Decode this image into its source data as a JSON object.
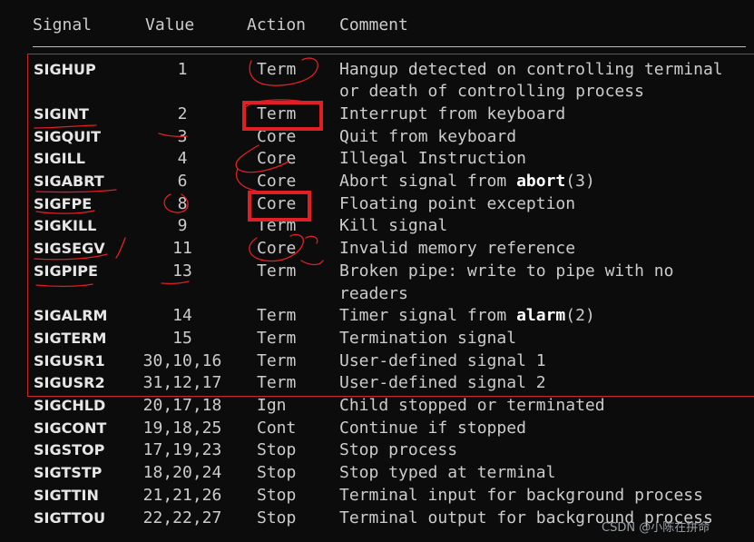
{
  "headers": {
    "signal": "Signal",
    "value": "Value",
    "action": "Action",
    "comment": "Comment"
  },
  "rows": [
    {
      "signal": "SIGHUP",
      "value": "1",
      "action": "Term",
      "comment": "Hangup detected on controlling terminal"
    },
    {
      "signal": "",
      "value": "",
      "action": "",
      "comment": "or death of controlling process"
    },
    {
      "signal": "SIGINT",
      "value": "2",
      "action": "Term",
      "comment": "Interrupt from keyboard"
    },
    {
      "signal": "SIGQUIT",
      "value": "3",
      "action": "Core",
      "comment": "Quit from keyboard"
    },
    {
      "signal": "SIGILL",
      "value": "4",
      "action": "Core",
      "comment": "Illegal Instruction"
    },
    {
      "signal": "SIGABRT",
      "value": "6",
      "action": "Core",
      "comment_pre": "Abort signal from ",
      "comment_kw": "abort",
      "comment_post": "(3)"
    },
    {
      "signal": "SIGFPE",
      "value": "8",
      "action": "Core",
      "comment": "Floating point exception"
    },
    {
      "signal": "SIGKILL",
      "value": "9",
      "action": "Term",
      "comment": "Kill signal"
    },
    {
      "signal": "SIGSEGV",
      "value": "11",
      "action": "Core",
      "comment": "Invalid memory reference"
    },
    {
      "signal": "SIGPIPE",
      "value": "13",
      "action": "Term",
      "comment": "Broken pipe: write to pipe with no"
    },
    {
      "signal": "",
      "value": "",
      "action": "",
      "comment": "readers"
    },
    {
      "signal": "SIGALRM",
      "value": "14",
      "action": "Term",
      "comment_pre": "Timer signal from ",
      "comment_kw": "alarm",
      "comment_post": "(2)"
    },
    {
      "signal": "SIGTERM",
      "value": "15",
      "action": "Term",
      "comment": "Termination signal"
    },
    {
      "signal": "SIGUSR1",
      "value": "30,10,16",
      "action": "Term",
      "comment": "User-defined signal 1"
    },
    {
      "signal": "SIGUSR2",
      "value": "31,12,17",
      "action": "Term",
      "comment": "User-defined signal 2"
    },
    {
      "signal": "SIGCHLD",
      "value": "20,17,18",
      "action": "Ign",
      "comment": "Child stopped or terminated"
    },
    {
      "signal": "SIGCONT",
      "value": "19,18,25",
      "action": "Cont",
      "comment": "Continue if stopped"
    },
    {
      "signal": "SIGSTOP",
      "value": "17,19,23",
      "action": "Stop",
      "comment": "Stop process"
    },
    {
      "signal": "SIGTSTP",
      "value": "18,20,24",
      "action": "Stop",
      "comment": "Stop typed at terminal"
    },
    {
      "signal": "SIGTTIN",
      "value": "21,21,26",
      "action": "Stop",
      "comment": "Terminal input for background process"
    },
    {
      "signal": "SIGTTOU",
      "value": "22,22,27",
      "action": "Stop",
      "comment": "Terminal output for background process"
    }
  ],
  "watermark": "CSDN @小陈在拼命",
  "colors": {
    "background": "#0c0c0c",
    "text": "#cccccc",
    "annotation": "#e01e26"
  }
}
